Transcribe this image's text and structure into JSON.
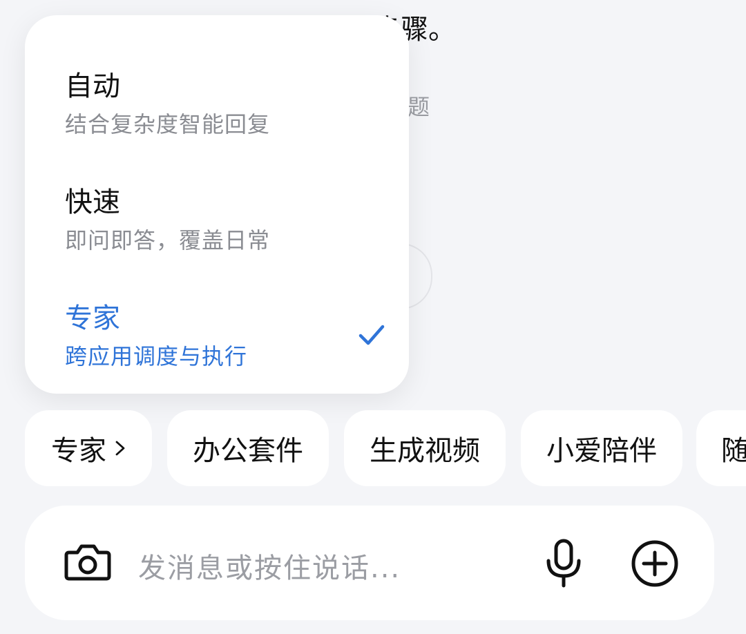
{
  "background": {
    "top_text": "步骤。",
    "side_text": "题"
  },
  "mode_menu": {
    "items": [
      {
        "title": "自动",
        "desc": "结合复杂度智能回复",
        "selected": false
      },
      {
        "title": "快速",
        "desc": "即问即答，覆盖日常",
        "selected": false
      },
      {
        "title": "专家",
        "desc": "跨应用调度与执行",
        "selected": true
      }
    ],
    "accent": "#2f74d8"
  },
  "chips": [
    {
      "label": "专家"
    },
    {
      "label": "办公套件"
    },
    {
      "label": "生成视频"
    },
    {
      "label": "小爱陪伴"
    },
    {
      "label": "随"
    }
  ],
  "input": {
    "placeholder": "发消息或按住说话..."
  },
  "icons": [
    "camera-icon",
    "microphone-icon",
    "plus-circle-icon",
    "checkmark-icon",
    "chevron-right-icon"
  ]
}
